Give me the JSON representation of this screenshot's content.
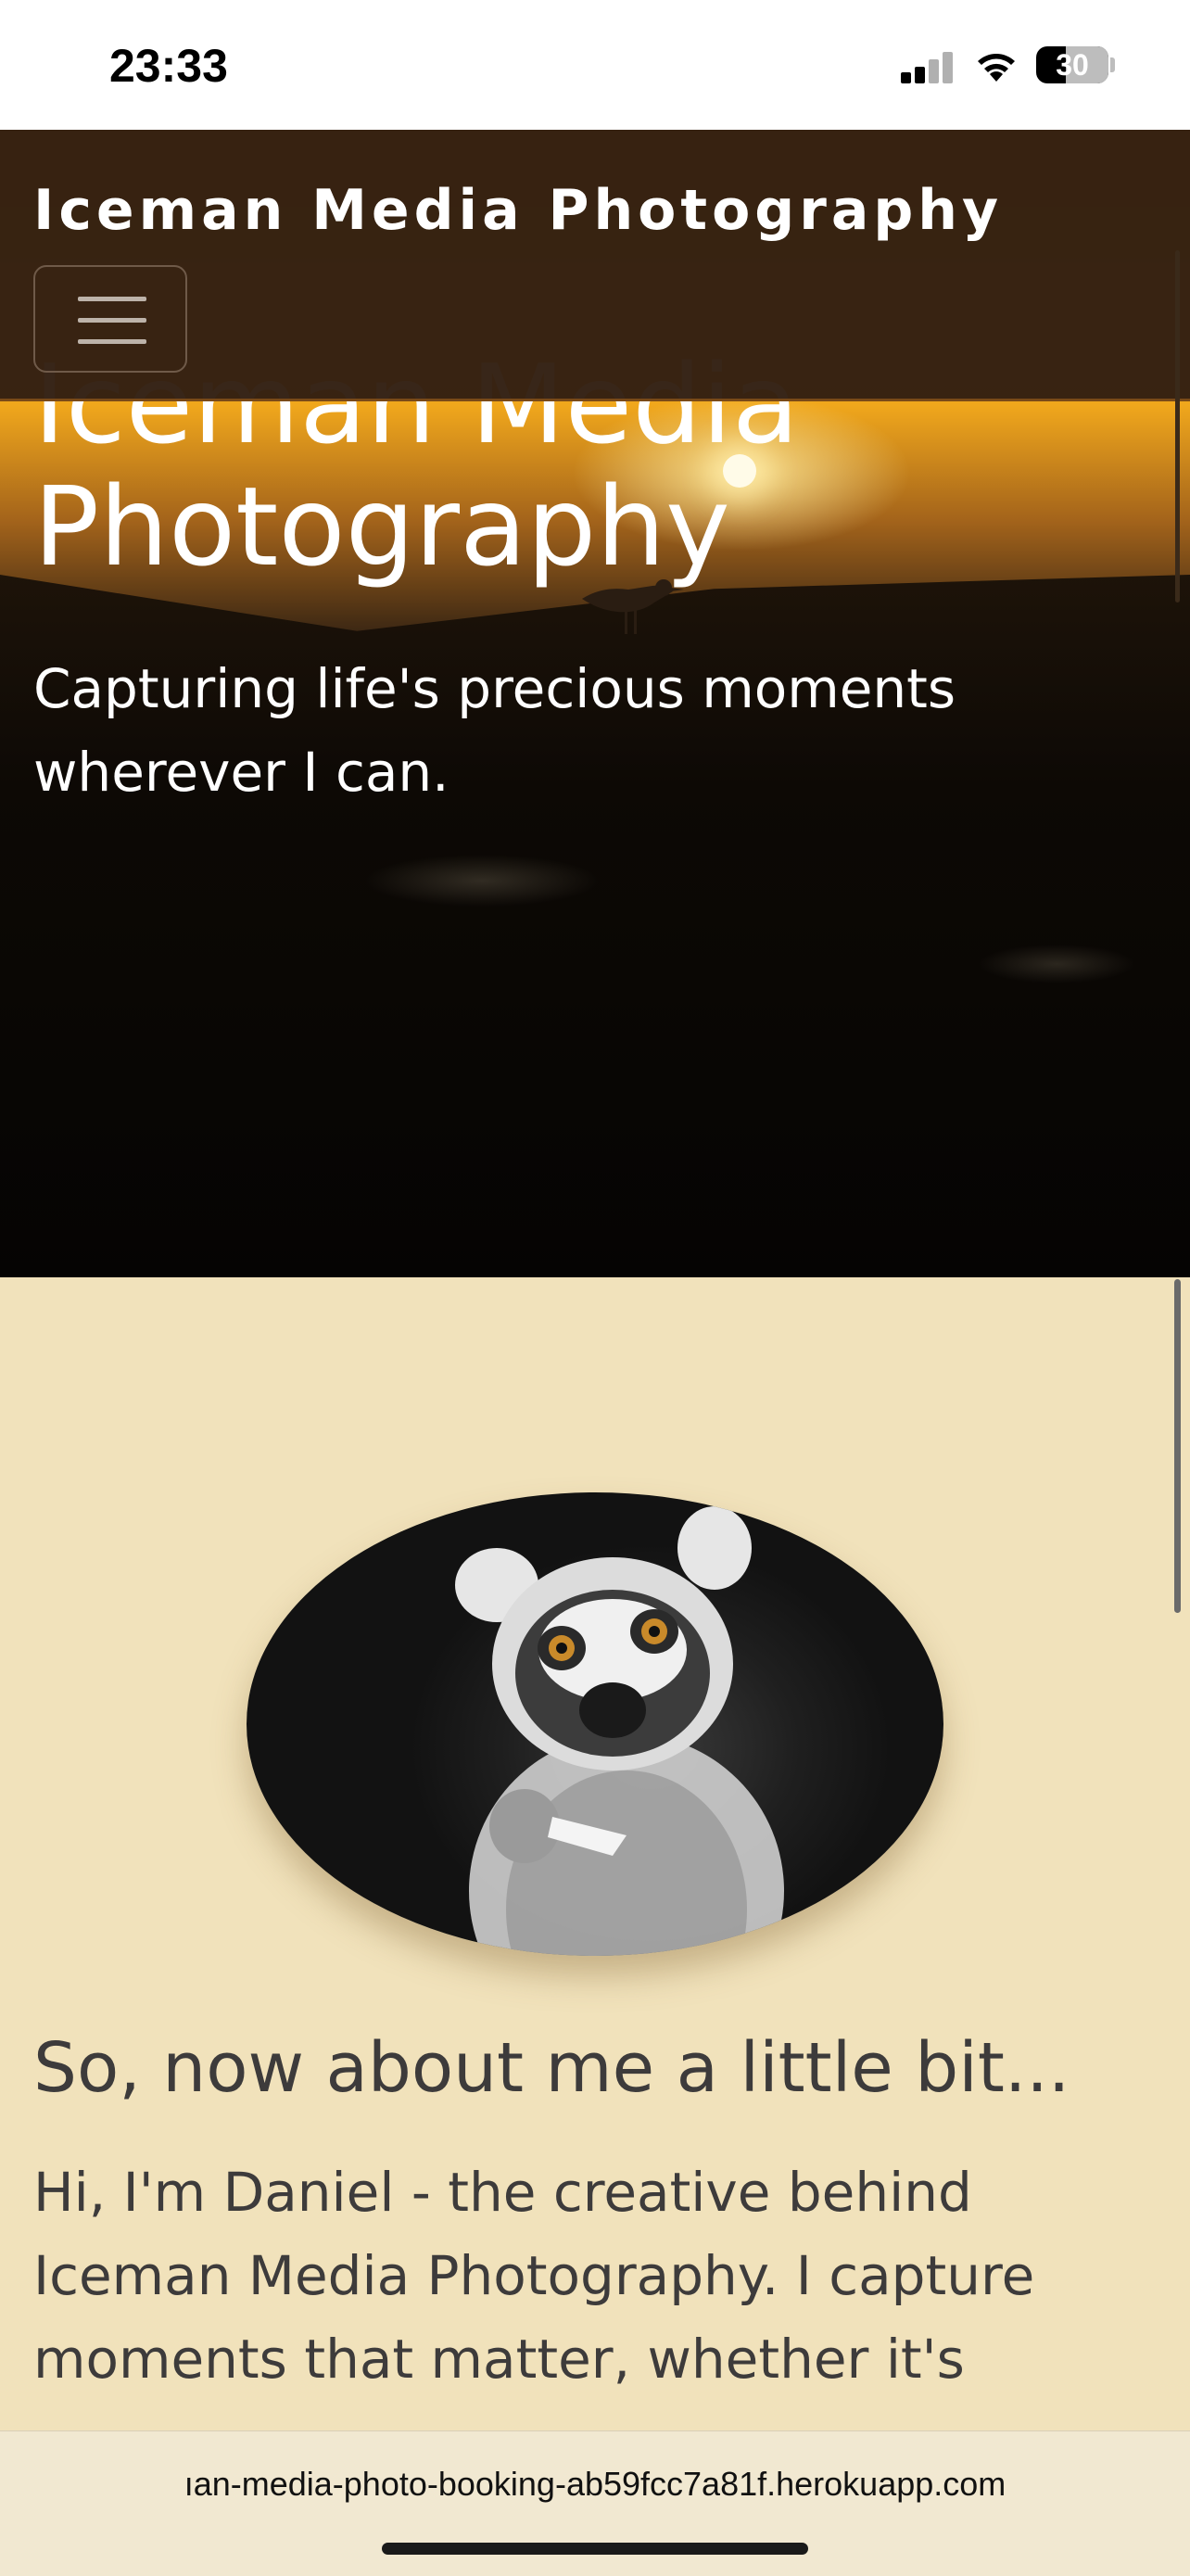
{
  "status_bar": {
    "time": "23:33",
    "battery": "30",
    "icons": [
      "signal-icon",
      "wifi-icon",
      "battery-icon"
    ]
  },
  "navbar": {
    "brand": "Iceman Media Photography",
    "menu_icon": "hamburger-icon"
  },
  "hero": {
    "title": "Iceman Media Photography",
    "subtitle": "Capturing life's precious moments wherever I can."
  },
  "about": {
    "heading": "So, now about me a little bit...",
    "text": "Hi, I'm Daniel - the creative behind Iceman Media Photography. I capture moments that matter, whether it's"
  },
  "browser": {
    "url": "ıan-media-photo-booking-ab59fcc7a81f.herokuapp.com"
  },
  "colors": {
    "navbar_bg": "#321f12",
    "page_bg": "#f1e2bb",
    "text_dark": "#3d3b3b"
  }
}
